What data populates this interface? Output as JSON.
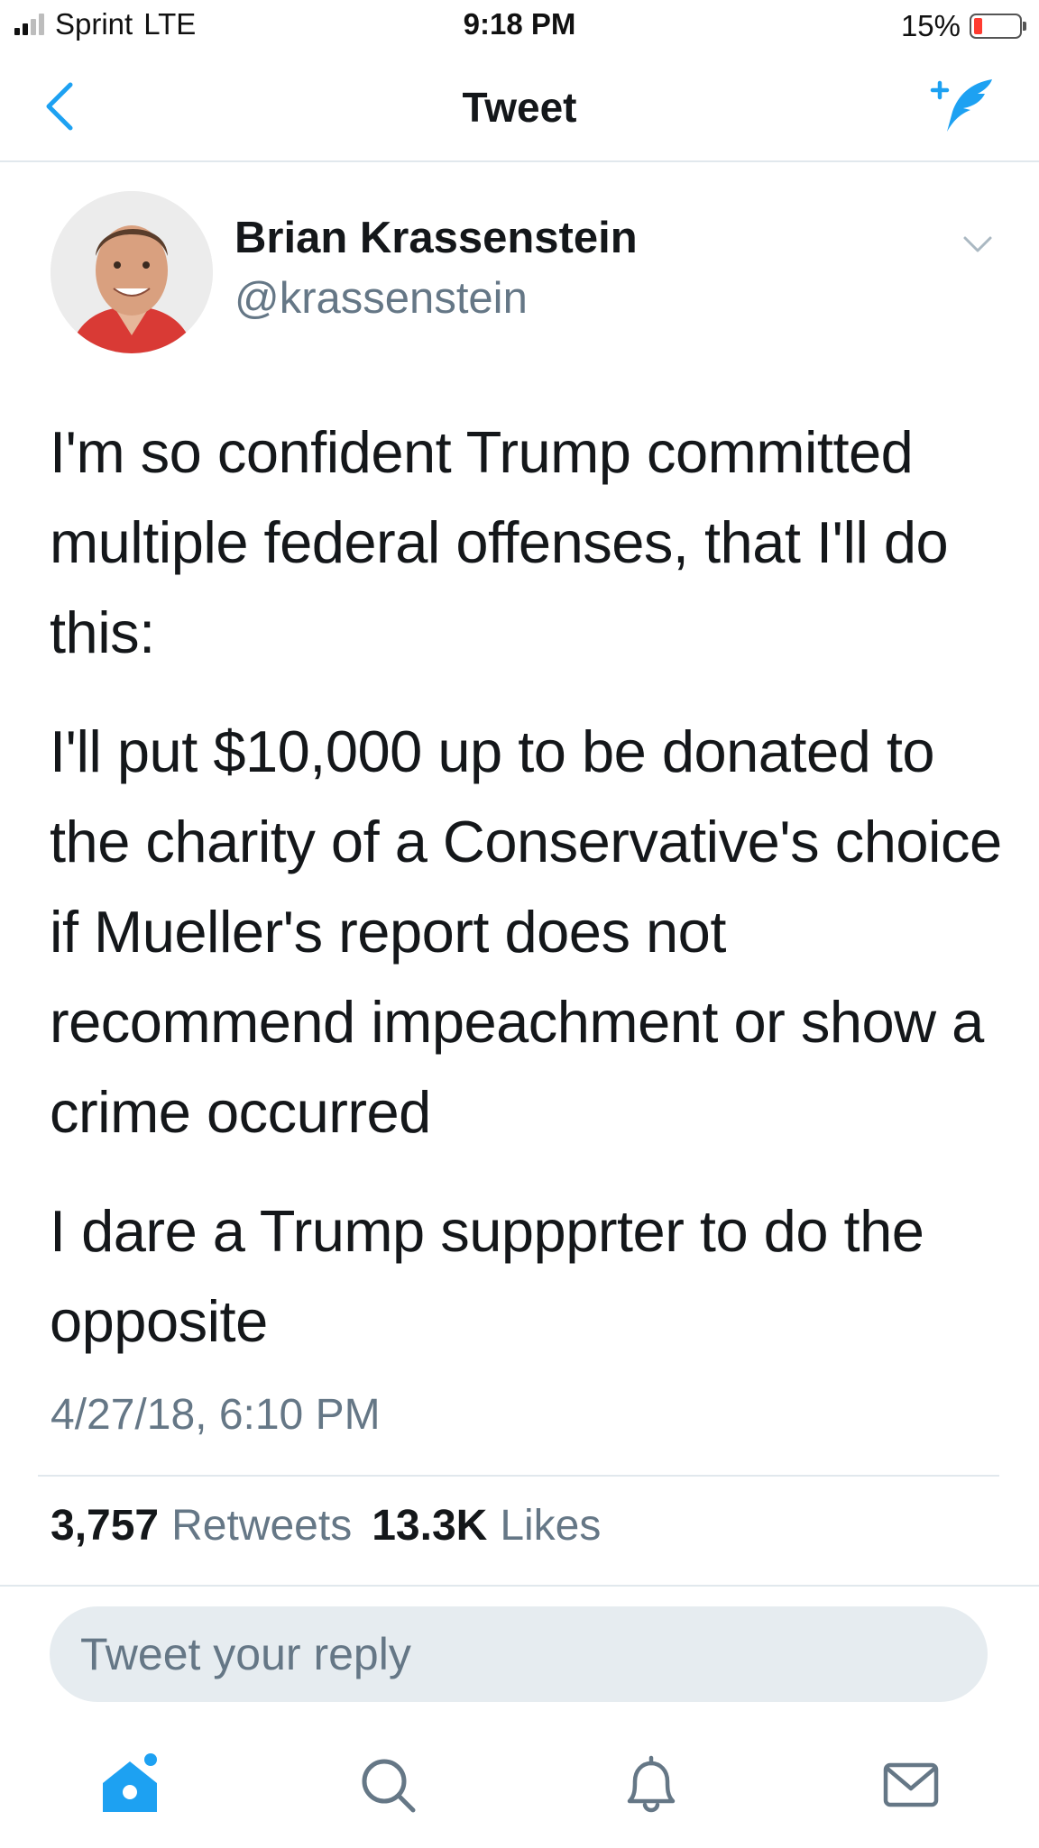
{
  "status_bar": {
    "carrier": "Sprint",
    "network": "LTE",
    "time": "9:18 PM",
    "battery": "15%",
    "battery_level": 0.15,
    "signal_bars": 2
  },
  "nav": {
    "title": "Tweet",
    "back_icon": "chevron-left-icon",
    "compose_icon": "compose-feather-icon"
  },
  "tweet": {
    "author_name": "Brian Krassenstein",
    "author_handle": "@krassenstein",
    "paragraphs": [
      "I'm so confident Trump committed multiple federal offenses, that I'll do this:",
      "I'll put $10,000 up to be donated to the charity of a Conservative's choice if Mueller's report does not recommend impeachment or show a crime occurred",
      "I dare a Trump suppprter to do the opposite"
    ],
    "timestamp": "4/27/18, 6:10 PM",
    "retweets_count": "3,757",
    "retweets_label": "Retweets",
    "likes_count": "13.3K",
    "likes_label": "Likes"
  },
  "reply": {
    "placeholder": "Tweet your reply"
  },
  "tab_bar": {
    "tabs": [
      "home-icon",
      "search-icon",
      "notifications-icon",
      "messages-icon"
    ],
    "active_color": "#1da1f2",
    "inactive_color": "#657786"
  }
}
